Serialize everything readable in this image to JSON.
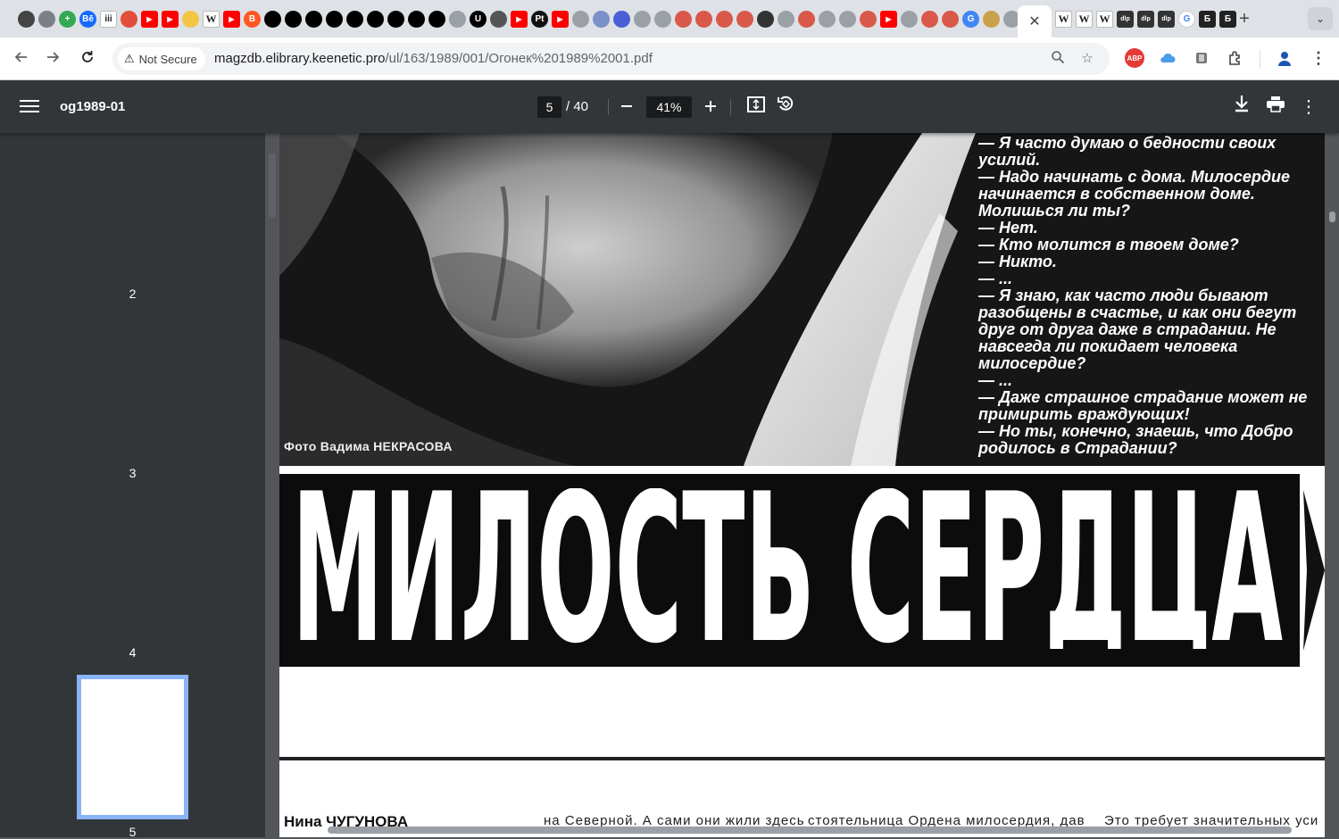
{
  "browser": {
    "tab_icons": [
      {
        "icon": "puzzle-icon",
        "color": "#444444",
        "text": ""
      },
      {
        "icon": "globe-icon",
        "color": "#7b7f86",
        "text": ""
      },
      {
        "icon": "plus-green-icon",
        "color": "#34a853",
        "text": "+"
      },
      {
        "icon": "behance-icon",
        "color": "#1769ff",
        "text": "Bē"
      },
      {
        "icon": "iiii-icon",
        "color": "#ffffff",
        "text": "iii"
      },
      {
        "icon": "site-icon",
        "color": "#e34d3c",
        "text": ""
      },
      {
        "icon": "youtube-icon",
        "color": "#ff0000",
        "text": "▶"
      },
      {
        "icon": "youtube-icon",
        "color": "#ff0000",
        "text": "▶"
      },
      {
        "icon": "emoji-icon",
        "color": "#f4c542",
        "text": ""
      },
      {
        "icon": "wikipedia-icon",
        "color": "#ffffff",
        "text": "W"
      },
      {
        "icon": "youtube-icon",
        "color": "#ff0000",
        "text": "▶"
      },
      {
        "icon": "blogger-icon",
        "color": "#ff5722",
        "text": "B"
      },
      {
        "icon": "black-circle-icon",
        "color": "#000000",
        "text": ""
      },
      {
        "icon": "black-circle-icon",
        "color": "#000000",
        "text": ""
      },
      {
        "icon": "black-circle-icon",
        "color": "#000000",
        "text": ""
      },
      {
        "icon": "black-circle-icon",
        "color": "#000000",
        "text": ""
      },
      {
        "icon": "black-circle-icon",
        "color": "#000000",
        "text": ""
      },
      {
        "icon": "black-circle-icon",
        "color": "#000000",
        "text": ""
      },
      {
        "icon": "black-circle-icon",
        "color": "#000000",
        "text": ""
      },
      {
        "icon": "black-circle-icon",
        "color": "#000000",
        "text": ""
      },
      {
        "icon": "black-circle-icon",
        "color": "#000000",
        "text": ""
      },
      {
        "icon": "site-icon",
        "color": "#9aa0a6",
        "text": ""
      },
      {
        "icon": "u-icon",
        "color": "#000000",
        "text": "U"
      },
      {
        "icon": "slash-icon",
        "color": "#555555",
        "text": ""
      },
      {
        "icon": "youtube-icon",
        "color": "#ff0000",
        "text": "▶"
      },
      {
        "icon": "pt-icon",
        "color": "#111111",
        "text": "Pt"
      },
      {
        "icon": "youtube-icon",
        "color": "#ff0000",
        "text": "▶"
      },
      {
        "icon": "site-icon",
        "color": "#9aa0a6",
        "text": ""
      },
      {
        "icon": "site-icon",
        "color": "#7b8fc9",
        "text": ""
      },
      {
        "icon": "site-icon",
        "color": "#4a5fd6",
        "text": ""
      },
      {
        "icon": "site-icon",
        "color": "#9aa0a6",
        "text": ""
      },
      {
        "icon": "site-icon",
        "color": "#9aa0a6",
        "text": ""
      },
      {
        "icon": "site-icon",
        "color": "#d9584a",
        "text": ""
      },
      {
        "icon": "site-icon",
        "color": "#d9584a",
        "text": ""
      },
      {
        "icon": "site-icon",
        "color": "#d9584a",
        "text": ""
      },
      {
        "icon": "site-icon",
        "color": "#d9584a",
        "text": ""
      },
      {
        "icon": "site-icon",
        "color": "#333333",
        "text": ""
      },
      {
        "icon": "site-icon",
        "color": "#9aa0a6",
        "text": ""
      },
      {
        "icon": "site-icon",
        "color": "#d9584a",
        "text": ""
      },
      {
        "icon": "site-icon",
        "color": "#9aa0a6",
        "text": ""
      },
      {
        "icon": "site-icon",
        "color": "#9aa0a6",
        "text": ""
      },
      {
        "icon": "site-icon",
        "color": "#d9584a",
        "text": ""
      },
      {
        "icon": "youtube-icon",
        "color": "#ff0000",
        "text": "▶"
      },
      {
        "icon": "site-icon",
        "color": "#9aa0a6",
        "text": ""
      },
      {
        "icon": "site-icon",
        "color": "#d9584a",
        "text": ""
      },
      {
        "icon": "site-icon",
        "color": "#d9584a",
        "text": ""
      },
      {
        "icon": "google-icon",
        "color": "#4285f4",
        "text": "G"
      },
      {
        "icon": "site-icon",
        "color": "#c9a14a",
        "text": ""
      },
      {
        "icon": "site-icon",
        "color": "#9aa0a6",
        "text": ""
      }
    ],
    "active_tab_close": "✕",
    "right_tab_icons": [
      {
        "icon": "wikipedia-icon",
        "text": "W"
      },
      {
        "icon": "wikipedia-icon",
        "text": "W"
      },
      {
        "icon": "wikipedia-icon",
        "text": "W"
      },
      {
        "icon": "dlp-icon",
        "text": "dlp"
      },
      {
        "icon": "dlp-icon",
        "text": "dlp"
      },
      {
        "icon": "dlp-icon",
        "text": "dlp"
      },
      {
        "icon": "google-icon",
        "text": "G"
      },
      {
        "icon": "b-icon",
        "text": "Б"
      },
      {
        "icon": "b-icon",
        "text": "Б"
      }
    ],
    "new_tab": "+",
    "tab_search": "⌄",
    "security_label": "Not Secure",
    "url_host": "magzdb.elibrary.keenetic.pro",
    "url_path": "/ul/163/1989/001/Огонек%201989%2001.pdf"
  },
  "pdf": {
    "title": "og1989-01",
    "current_page": "5",
    "total_pages": "/ 40",
    "zoom": "41%",
    "thumbnails": [
      "2",
      "3",
      "4",
      "5"
    ],
    "colors": {
      "toolbar": "#323639",
      "active_thumb_border": "#8ab4f8"
    }
  },
  "page": {
    "photo_credit": "Фото Вадима НЕКРАСОВА",
    "dialogue_lines": [
      "— Я часто думаю о бедности своих",
      "усилий.",
      "— Надо начинать с дома. Милосердие",
      "начинается в собственном доме.",
      "Молишься ли ты?",
      "— Нет.",
      "— Кто молится в твоем доме?",
      "— Никто.",
      "— ...",
      "— Я знаю, как часто люди бывают",
      "разобщены в счастье, и как они бегут",
      "друг от друга даже в страдании. Не",
      "навсегда ли покидает человека",
      "милосердие?",
      "— ...",
      "— Даже страшное страдание может не",
      "примирить враждующих!",
      "— Но ты, конечно, знаешь, что Добро",
      "родилось в Страдании?"
    ],
    "headline": "МИЛОСТЬ СЕРДЦА",
    "author": "Нина ЧУГУНОВА",
    "column_snippets": [
      "на Северной. А сами они жили здесь",
      "стоятельница Ордена милосердия, дав",
      "Это требует значительных уси"
    ]
  }
}
